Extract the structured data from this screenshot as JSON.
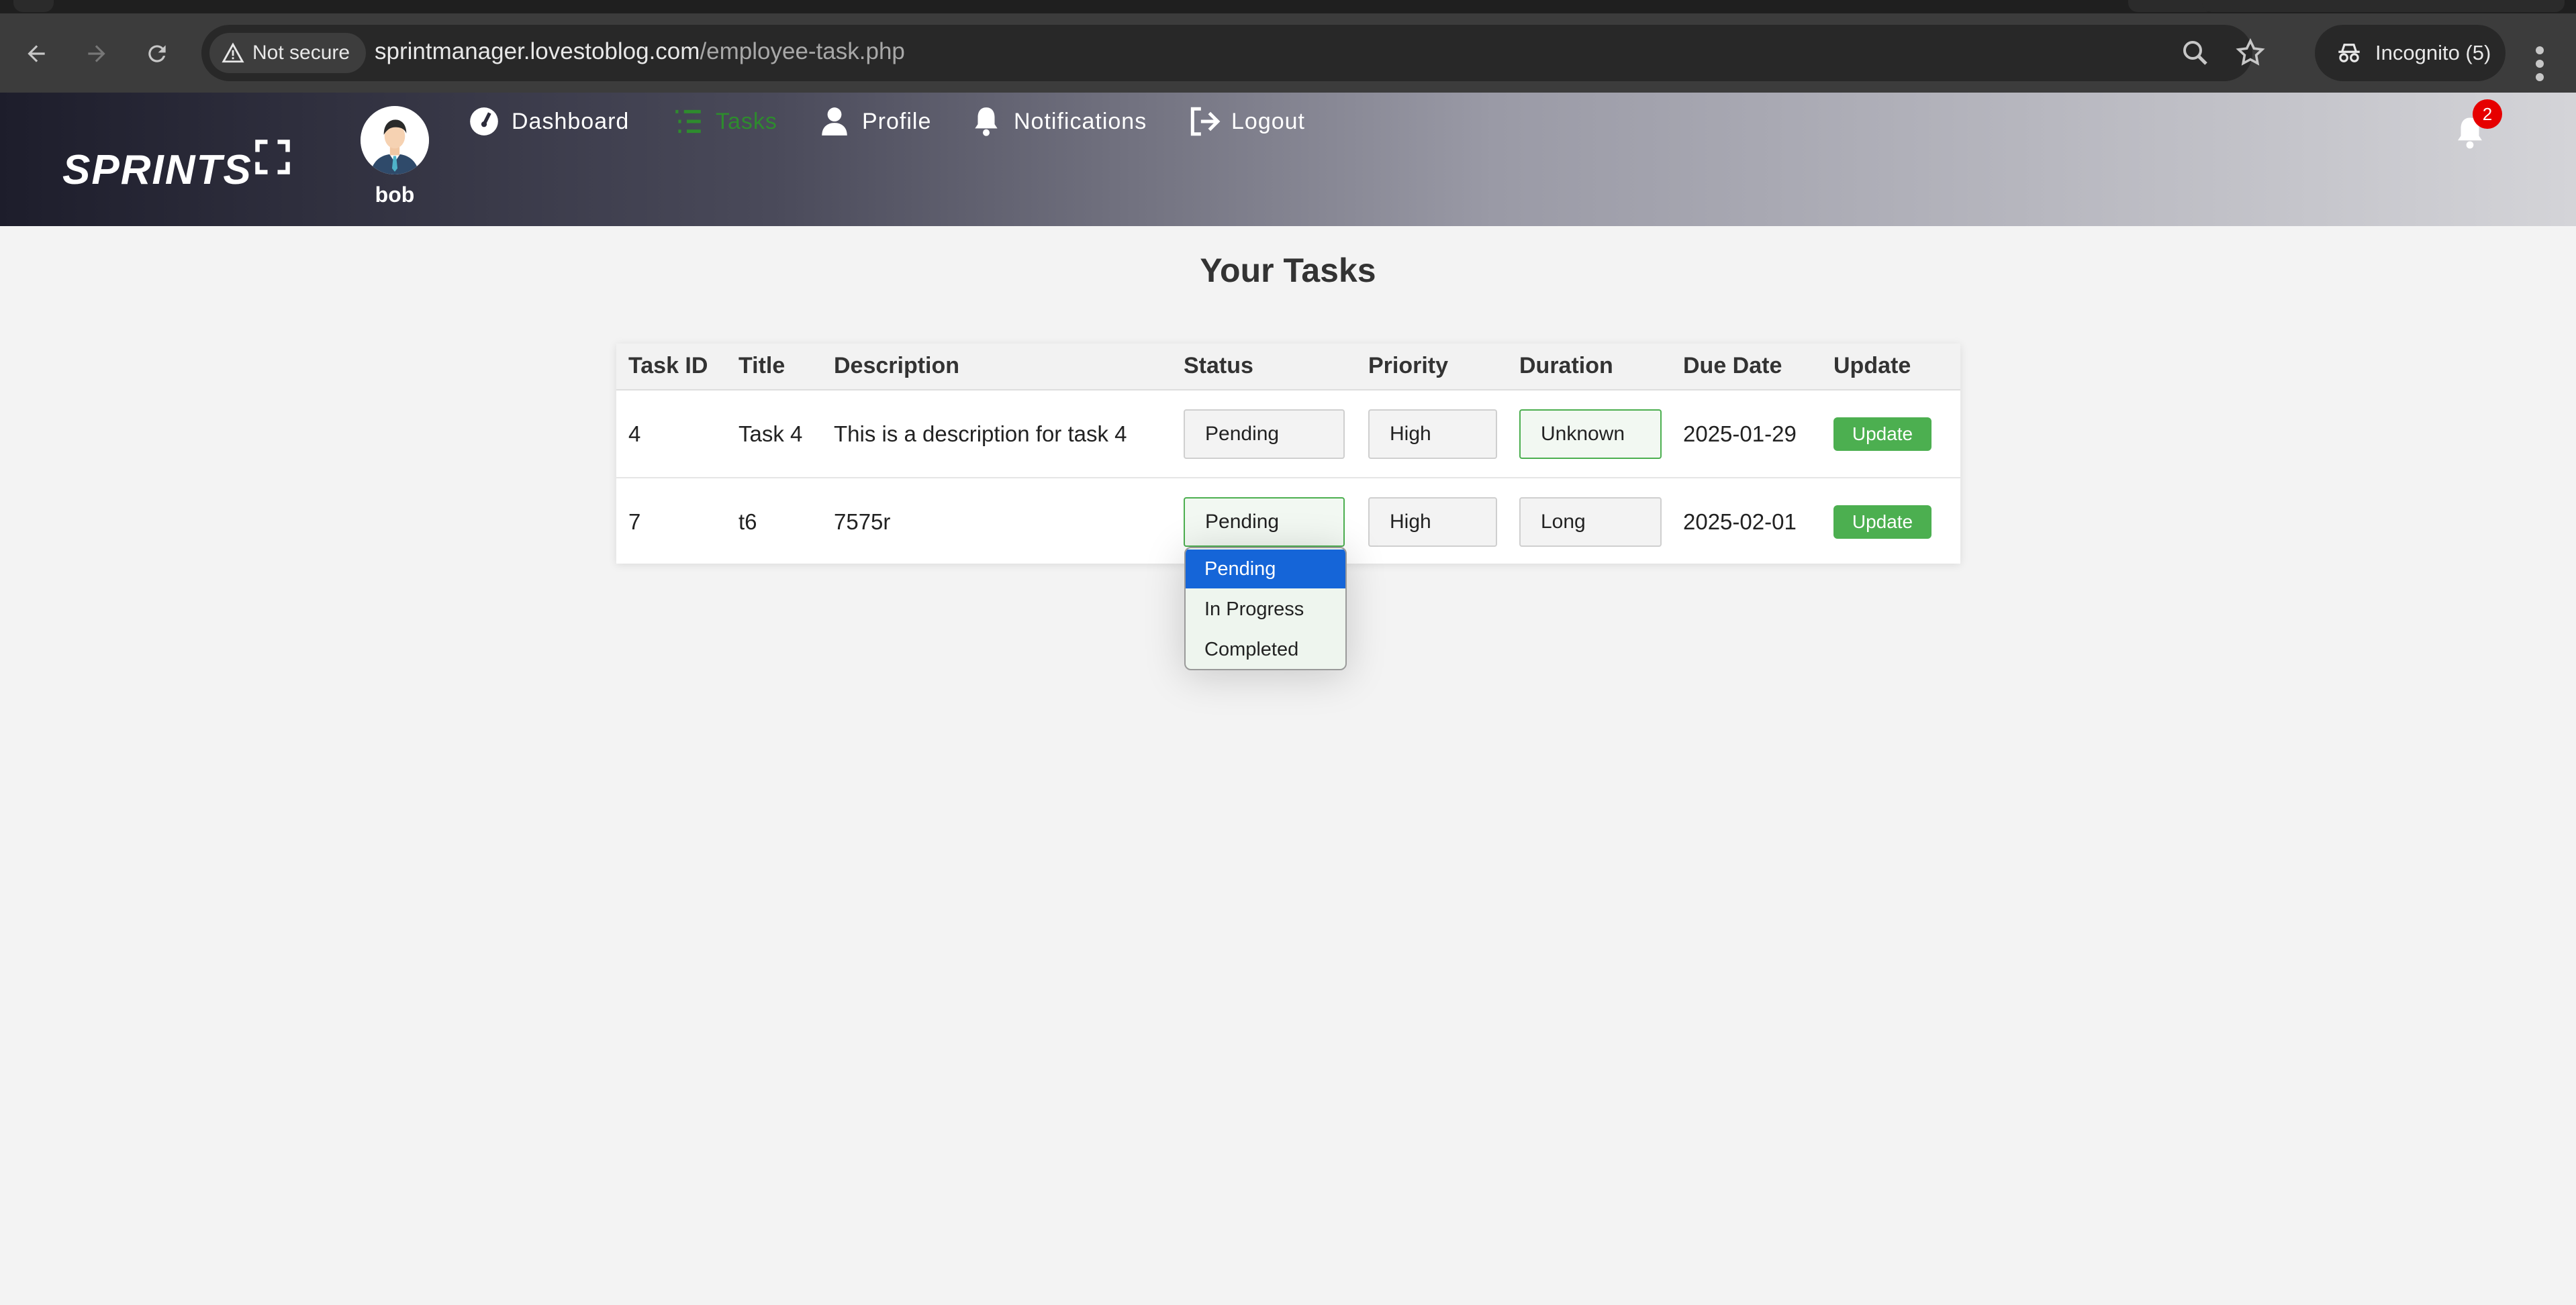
{
  "browser": {
    "security_label": "Not secure",
    "url_host": "sprintmanager.lovestoblog.com",
    "url_path": "/employee-task.php",
    "incognito_label": "Incognito (5)"
  },
  "app": {
    "brand": "SPRINTS",
    "username": "bob",
    "notification_count": "2",
    "nav": [
      {
        "label": "Dashboard",
        "icon": "gauge-icon"
      },
      {
        "label": "Tasks",
        "icon": "list-icon",
        "active": true
      },
      {
        "label": "Profile",
        "icon": "user-icon"
      },
      {
        "label": "Notifications",
        "icon": "bell-icon"
      },
      {
        "label": "Logout",
        "icon": "logout-icon"
      }
    ],
    "colors": {
      "accent": "#4caf50",
      "active_nav": "#2e8b2e",
      "badge": "#e60000",
      "selected_option": "#1565d8"
    }
  },
  "main": {
    "title": "Your Tasks",
    "columns": [
      "Task ID",
      "Title",
      "Description",
      "Status",
      "Priority",
      "Duration",
      "Due Date",
      "Update"
    ],
    "rows": [
      {
        "id": "4",
        "title": "Task 4",
        "description": "This is a description for task 4",
        "status": "Pending",
        "priority": "High",
        "duration": "Unknown",
        "due": "2025-01-29",
        "update": "Update"
      },
      {
        "id": "7",
        "title": "t6",
        "description": "7575r",
        "status": "Pending",
        "priority": "High",
        "duration": "Long",
        "due": "2025-02-01",
        "update": "Update"
      }
    ],
    "status_options": [
      "Pending",
      "In Progress",
      "Completed"
    ]
  }
}
